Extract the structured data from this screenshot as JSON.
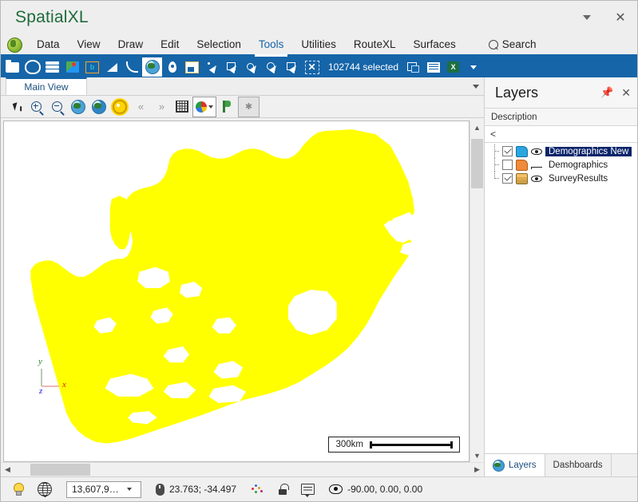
{
  "window": {
    "title": "SpatialXL",
    "controls": {
      "dropdown": "▾",
      "close": "✕"
    }
  },
  "menubar": {
    "app_icon": "globe-green-icon",
    "items": [
      {
        "label": "Data",
        "active": false
      },
      {
        "label": "View",
        "active": false
      },
      {
        "label": "Draw",
        "active": false
      },
      {
        "label": "Edit",
        "active": false
      },
      {
        "label": "Selection",
        "active": false
      },
      {
        "label": "Tools",
        "active": true
      },
      {
        "label": "Utilities",
        "active": false
      },
      {
        "label": "RouteXL",
        "active": false
      },
      {
        "label": "Surfaces",
        "active": false
      }
    ],
    "search_label": "Search"
  },
  "ribbon": {
    "accent_color": "#1565a8",
    "selection_text": "102744 selected",
    "icons": [
      "open-folder-icon",
      "palette-icon",
      "layers-icon",
      "map-image-icon",
      "bounding-box-icon",
      "triangle-measure-icon",
      "curve-tool-icon",
      "globe-view-icon",
      "map-pin-icon",
      "window-map-icon",
      "select-point-icon",
      "select-rect-icon",
      "select-circle-icon",
      "select-lasso-icon",
      "select-polygon-icon",
      "clear-selection-icon",
      "selection-copy-icon",
      "attribute-table-icon",
      "export-excel-icon",
      "overflow-arrow-icon"
    ]
  },
  "view": {
    "tab_label": "Main View",
    "toolbar_icons": [
      "pointer-icon",
      "zoom-in-icon",
      "zoom-out-icon",
      "globe-zoom-extent-icon",
      "globe-zoom-selected-icon",
      "settings-gear-icon",
      "previous-extent-icon",
      "next-extent-icon",
      "grid-icon",
      "thematic-palette-icon",
      "palette-dropdown-arrow-icon",
      "bookmark-flag-icon",
      "favorite-star-icon"
    ]
  },
  "map": {
    "fill_color": "#FFFF00",
    "background_color": "#FFFFFF",
    "axis_indicator": {
      "x_label": "x",
      "x_color": "#e01b1b",
      "y_label": "y",
      "y_color": "#1e8a1e",
      "z_label": "z",
      "z_color": "#1b1bdd"
    },
    "scalebar": {
      "label": "300km"
    }
  },
  "layers_panel": {
    "title": "Layers",
    "pin_icon": "pin-icon",
    "close_icon": "close-icon",
    "column_header": "Description",
    "filter_value": "<",
    "rows": [
      {
        "name": "Demographics New",
        "checked": true,
        "selected": true,
        "layer_icon": "polygon-blue-icon",
        "vis_icon": "binoculars-icon"
      },
      {
        "name": "Demographics",
        "checked": false,
        "selected": false,
        "layer_icon": "polygon-orange-icon",
        "vis_icon": "eye-closed-icon"
      },
      {
        "name": "SurveyResults",
        "checked": true,
        "selected": false,
        "layer_icon": "table-stack-icon",
        "vis_icon": "eye-open-icon"
      }
    ],
    "tabs": [
      {
        "label": "Layers",
        "active": true,
        "icon": "globe-icon"
      },
      {
        "label": "Dashboards",
        "active": false,
        "icon": ""
      }
    ]
  },
  "statusbar": {
    "hint_icon": "lightbulb-icon",
    "projection_icon": "wireframe-globe-icon",
    "scale_value": "13,607,9…",
    "mouse_icon": "mouse-icon",
    "coordinates": "23.763; -34.497",
    "points_icon": "points-icon",
    "lock_icon": "unlocked-padlock-icon",
    "annotation_icon": "note-icon",
    "view_icon": "eye-icon",
    "view_angles": "-90.00, 0.00, 0.00"
  }
}
